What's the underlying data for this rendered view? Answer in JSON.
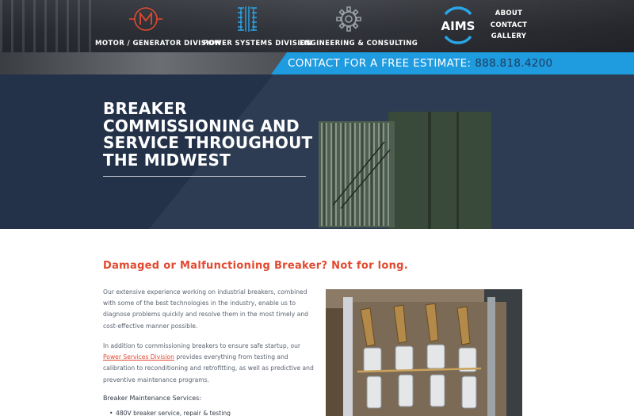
{
  "header": {
    "nav": [
      {
        "label": "MOTOR / GENERATOR DIVISION",
        "icon": "motor-m-icon"
      },
      {
        "label": "POWER SYSTEMS DIVISION",
        "icon": "transformer-icon"
      },
      {
        "label": "ENGINEERING & CONSULTING",
        "icon": "gear-icon"
      }
    ],
    "logo_text": "AIMS",
    "top_links": [
      "ABOUT",
      "CONTACT",
      "GALLERY"
    ],
    "estimate_label": "CONTACT FOR A FREE ESTIMATE:",
    "estimate_phone": "888.818.4200"
  },
  "hero": {
    "title_lines": [
      "BREAKER",
      "COMMISSIONING AND",
      "SERVICE THROUGHOUT",
      "THE MIDWEST"
    ]
  },
  "content": {
    "heading": "Damaged or Malfunctioning Breaker? Not for long.",
    "paragraph1": "Our extensive experience working on industrial breakers, combined with some of the best technologies in the industry, enable us to diagnose problems quickly and resolve them in the most timely and cost-effective manner possible.",
    "paragraph2_before": "In addition to commissioning breakers to ensure safe startup, our ",
    "paragraph2_link": "Power Services Division",
    "paragraph2_after": " provides everything from testing and calibration to reconditioning and retrofitting, as well as predictive and preventive maintenance programs.",
    "services_heading": "Breaker Maintenance Services:",
    "services": [
      "480V breaker service, repair & testing"
    ]
  },
  "colors": {
    "accent_red": "#e2492f",
    "accent_blue": "#1f9be0",
    "hero_bg": "#2d3c52"
  }
}
